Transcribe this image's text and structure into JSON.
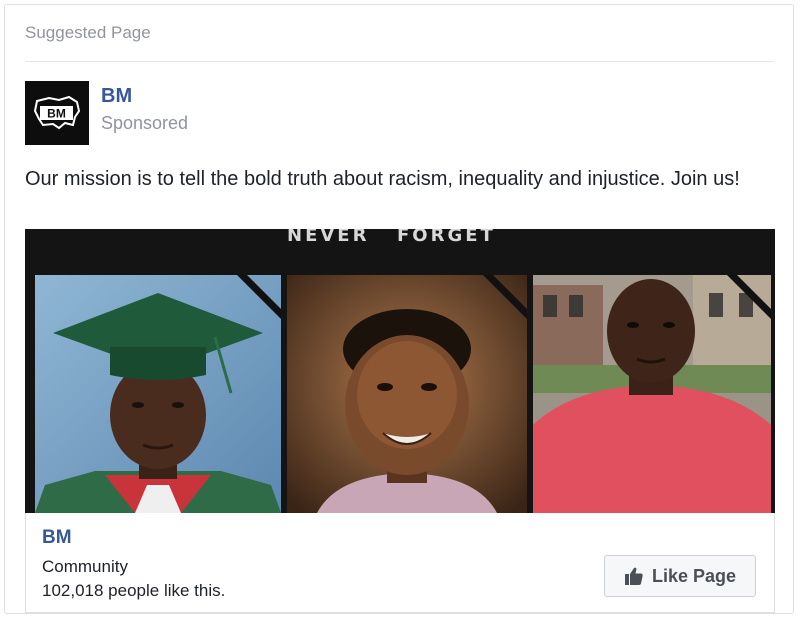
{
  "header": {
    "suggested_label": "Suggested Page"
  },
  "page": {
    "name": "BM",
    "sponsored_label": "Sponsored",
    "logo_text": "BM",
    "brand_color": "#365899"
  },
  "post": {
    "text": "Our mission is to tell the bold truth about racism, inequality and injustice. Join us!"
  },
  "ad_image": {
    "banner_left": "NEVER",
    "banner_right": "FORGET",
    "photos": [
      "portrait-graduation",
      "portrait-smiling-boy",
      "portrait-man-red-shirt"
    ]
  },
  "footer": {
    "page_name": "BM",
    "category": "Community",
    "likes_text": "102,018 people like this.",
    "like_button_label": "Like Page",
    "like_icon": "thumbs-up-icon"
  }
}
